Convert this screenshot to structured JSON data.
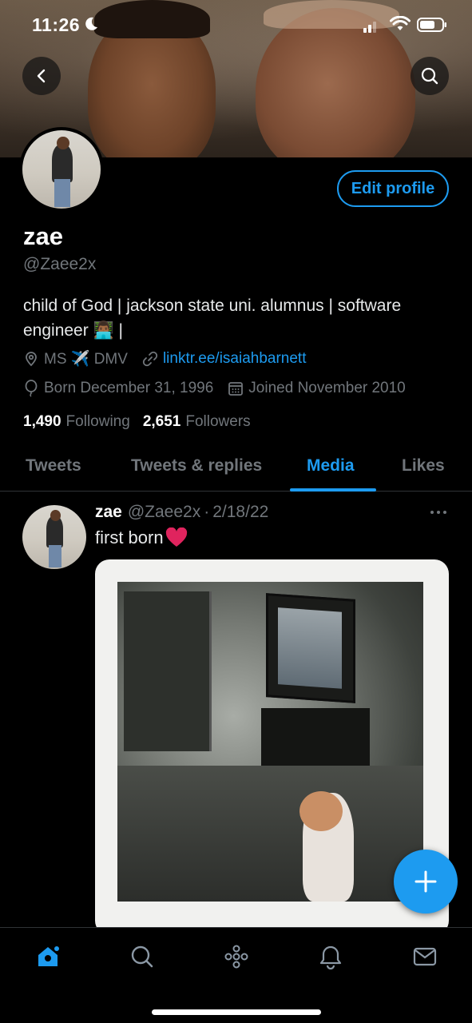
{
  "status_bar": {
    "time": "11:26"
  },
  "profile": {
    "name": "zae",
    "handle": "@Zaee2x",
    "bio": "child of God | jackson state uni. alumnus | software engineer 👨🏾‍💻 |",
    "location": "MS ✈️ DMV",
    "link": "linktr.ee/isaiahbarnett",
    "born": "Born December 31, 1996",
    "joined": "Joined November 2010",
    "following_count": "1,490",
    "following_label": "Following",
    "followers_count": "2,651",
    "followers_label": "Followers",
    "edit_label": "Edit profile"
  },
  "tabs": [
    {
      "label": "Tweets"
    },
    {
      "label": "Tweets & replies"
    },
    {
      "label": "Media",
      "active": true
    },
    {
      "label": "Likes"
    }
  ],
  "tweet": {
    "name": "zae",
    "handle": "@Zaee2x",
    "separator": "·",
    "date": "2/18/22",
    "text": "first born",
    "more": "···"
  },
  "colors": {
    "accent": "#1d9bf0",
    "background": "#000000",
    "secondary_text": "#71767b",
    "heart": "#e0245e"
  },
  "icons": {
    "back": "chevron-left-icon",
    "search": "search-icon",
    "location": "location-pin-icon",
    "link": "link-icon",
    "birthday": "balloon-icon",
    "joined": "calendar-icon",
    "compose": "plus-icon",
    "nav": [
      "home-icon",
      "search-icon",
      "spaces-icon",
      "bell-icon",
      "mail-icon"
    ]
  }
}
